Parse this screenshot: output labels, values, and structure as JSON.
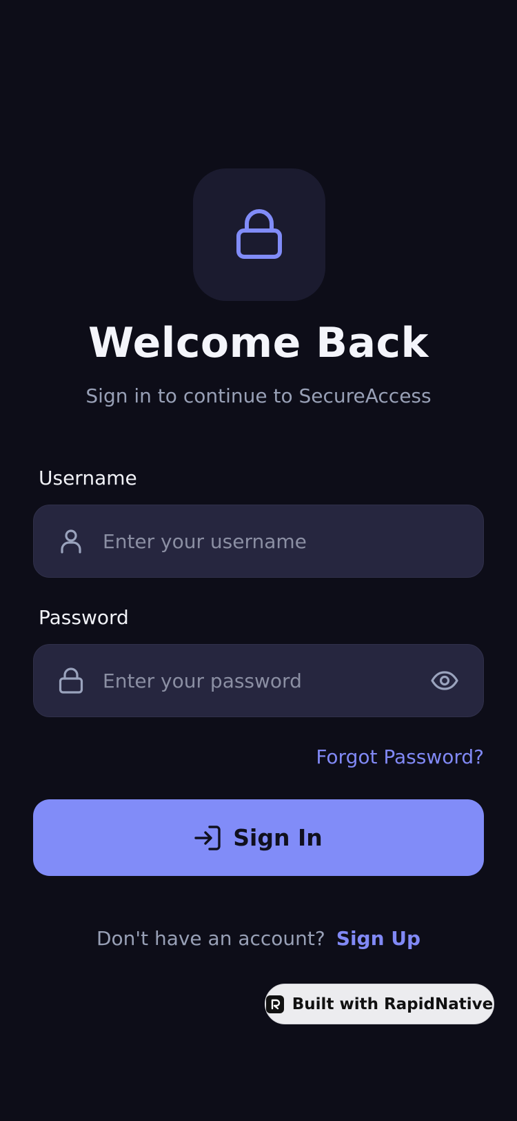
{
  "header": {
    "icon": "lock-icon",
    "title": "Welcome Back",
    "subtitle": "Sign in to continue to SecureAccess"
  },
  "form": {
    "username": {
      "label": "Username",
      "placeholder": "Enter your username",
      "value": "",
      "icon": "user-icon"
    },
    "password": {
      "label": "Password",
      "placeholder": "Enter your password",
      "value": "",
      "icon": "lock-icon",
      "toggle_icon": "eye-icon"
    },
    "forgot_password": "Forgot Password?",
    "submit_label": "Sign In",
    "submit_icon": "log-in-icon"
  },
  "footer": {
    "prompt": "Don't have an account?",
    "signup_link": "Sign Up"
  },
  "badge": {
    "label": "Built with RapidNative"
  },
  "colors": {
    "background": "#0d0d18",
    "accent": "#818cf8",
    "field_bg": "#26263f",
    "logo_bg": "#1b1b2f",
    "text_primary": "#f4f5fb",
    "text_muted": "#98a0b6"
  }
}
